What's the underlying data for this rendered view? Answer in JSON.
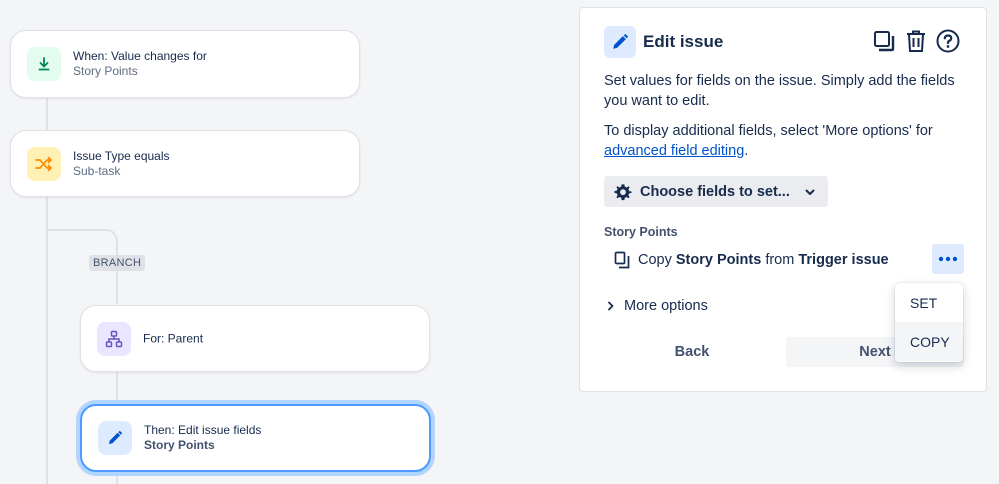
{
  "flow": {
    "branch_tag": "BRANCH",
    "trigger": {
      "line1": "When: Value changes for",
      "line2": "Story Points",
      "icon": "download-arrow-icon",
      "color": "#e3fcef"
    },
    "condition": {
      "line1": "Issue Type equals",
      "line2": "Sub-task",
      "icon": "shuffle-icon",
      "color": "#fff0b3"
    },
    "branch": {
      "line1": "For: Parent",
      "icon": "hierarchy-icon",
      "color": "#eae6ff"
    },
    "action": {
      "line1": "Then: Edit issue fields",
      "line2": "Story Points",
      "icon": "pencil-icon",
      "color": "#deebff"
    }
  },
  "panel": {
    "title": "Edit issue",
    "desc": "Set values for fields on the issue. Simply add the fields you want to edit.",
    "more_info_prefix": "To display additional fields, select 'More options' for",
    "more_info_link": "advanced field editing",
    "more_info_suffix": ".",
    "choose_fields": "Choose fields to set...",
    "field_label": "Story Points",
    "copy_prefix": "Copy",
    "copy_field": "Story Points",
    "copy_from": "from",
    "copy_source": "Trigger issue",
    "more_options": "More options",
    "back": "Back",
    "next": "Next"
  },
  "dropdown": {
    "items": [
      "SET",
      "COPY"
    ],
    "selected": "COPY"
  },
  "colors": {
    "accent": "#0052cc",
    "selection_ring": "#4c9aff"
  }
}
